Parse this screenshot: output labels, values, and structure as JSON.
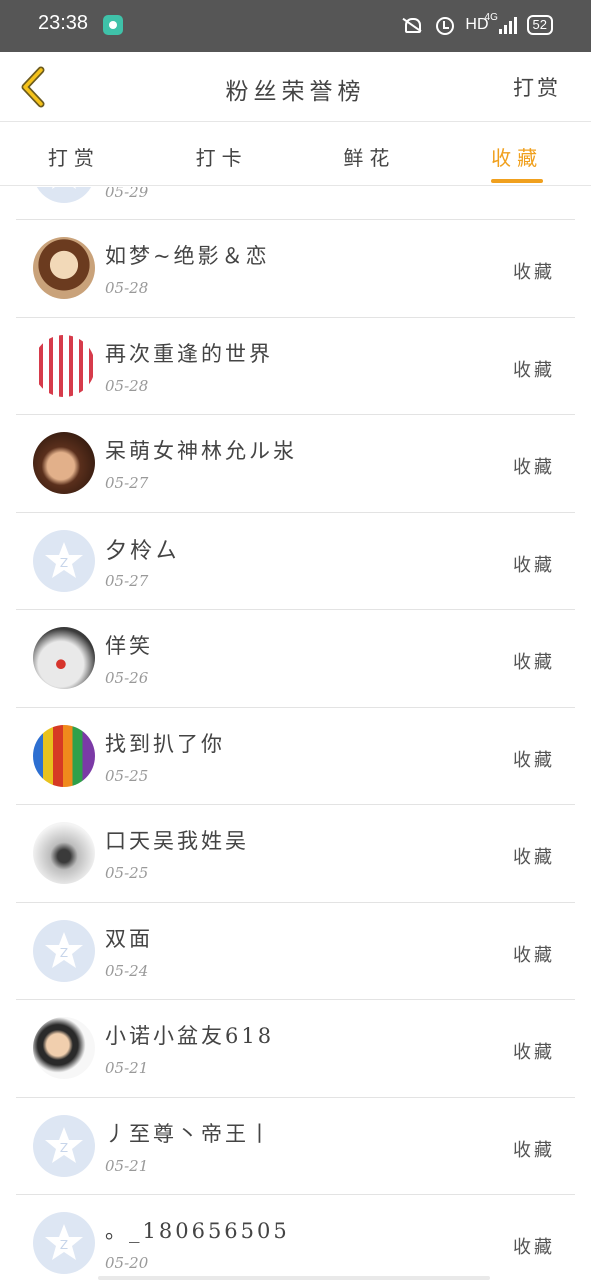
{
  "status_bar": {
    "time": "23:38",
    "hd_label": "HD",
    "network_label": "4G",
    "battery": "52"
  },
  "header": {
    "title": "粉丝荣誉榜",
    "action": "打赏"
  },
  "tabs": [
    {
      "label": "打赏",
      "active": false
    },
    {
      "label": "打卡",
      "active": false
    },
    {
      "label": "鲜花",
      "active": false
    },
    {
      "label": "收藏",
      "active": true
    }
  ],
  "list": {
    "partial_date": "05-29",
    "items": [
      {
        "name": "如梦~绝影＆恋",
        "date": "05-28",
        "action": "收藏",
        "avatar": "photo"
      },
      {
        "name": "再次重逢的世界",
        "date": "05-28",
        "action": "收藏",
        "avatar": "photo"
      },
      {
        "name": "呆萌女神林允ル汖",
        "date": "05-27",
        "action": "收藏",
        "avatar": "photo"
      },
      {
        "name": "夕柃ㄙ",
        "date": "05-27",
        "action": "收藏",
        "avatar": "default"
      },
      {
        "name": "佯笑",
        "date": "05-26",
        "action": "收藏",
        "avatar": "photo"
      },
      {
        "name": "找到扒了你",
        "date": "05-25",
        "action": "收藏",
        "avatar": "photo"
      },
      {
        "name": "口天吴我姓吴",
        "date": "05-25",
        "action": "收藏",
        "avatar": "photo"
      },
      {
        "name": "双面",
        "date": "05-24",
        "action": "收藏",
        "avatar": "default"
      },
      {
        "name": "小诺小盆友618",
        "date": "05-21",
        "action": "收藏",
        "avatar": "photo"
      },
      {
        "name": "丿至尊丶帝王丨",
        "date": "05-21",
        "action": "收藏",
        "avatar": "default"
      },
      {
        "name": "。_180656505",
        "date": "05-20",
        "action": "收藏",
        "avatar": "default"
      }
    ]
  },
  "colors": {
    "accent": "#f0a01e",
    "status_bar": "#565656",
    "default_avatar": "#dde6f3"
  }
}
